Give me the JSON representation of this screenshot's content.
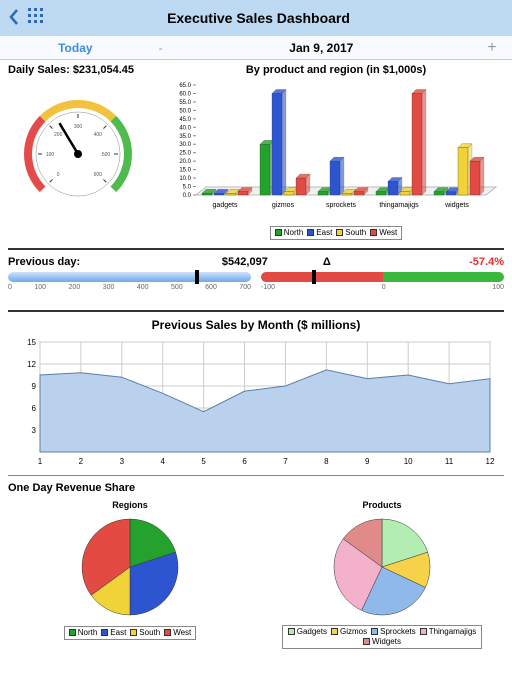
{
  "header": {
    "title": "Executive Sales Dashboard"
  },
  "subheader": {
    "today": "Today",
    "date": "Jan 9, 2017",
    "minus": "-",
    "plus": "+"
  },
  "daily": {
    "label": "Daily Sales: $231,054.45"
  },
  "byproduct": {
    "label": "By product and region (in $1,000s)"
  },
  "prev": {
    "label": "Previous day:",
    "value": "$542,097",
    "delta_label": "Δ",
    "delta_value": "-57.4%"
  },
  "month": {
    "title": "Previous Sales by Month ($ millions)"
  },
  "share": {
    "title": "One Day Revenue Share",
    "regions": "Regions",
    "products": "Products"
  },
  "legend1": [
    "North",
    "East",
    "South",
    "West"
  ],
  "legend2": [
    "Gadgets",
    "Gizmos",
    "Sprockets",
    "Thingamajigs",
    "Widgets"
  ],
  "chart_data": [
    {
      "type": "gauge",
      "title": "Daily Sales",
      "range": [
        0,
        600
      ],
      "ticks": [
        0,
        100,
        200,
        300,
        400,
        500,
        600
      ],
      "value": 231,
      "bands": [
        {
          "from": 0,
          "to": 200,
          "color": "#e54b4b"
        },
        {
          "from": 200,
          "to": 400,
          "color": "#f0c23d"
        },
        {
          "from": 400,
          "to": 600,
          "color": "#4fbb4f"
        }
      ]
    },
    {
      "type": "bar",
      "title": "By product and region (in $1,000s)",
      "categories": [
        "gadgets",
        "gizmos",
        "sprockets",
        "thingamajigs",
        "widgets"
      ],
      "series": [
        {
          "name": "North",
          "color": "#25a22e",
          "values": [
            1,
            30,
            2,
            2,
            2
          ]
        },
        {
          "name": "East",
          "color": "#2d55d0",
          "values": [
            1,
            60,
            20,
            8,
            2
          ]
        },
        {
          "name": "South",
          "color": "#f0d338",
          "values": [
            1,
            2,
            1,
            2,
            28
          ]
        },
        {
          "name": "West",
          "color": "#e24a42",
          "values": [
            2,
            10,
            2,
            60,
            20
          ]
        }
      ],
      "ylim": [
        0,
        65
      ],
      "yticks": [
        0,
        5,
        10,
        15,
        20,
        25,
        30,
        35,
        40,
        45,
        50,
        55,
        60,
        65
      ]
    },
    {
      "type": "bullet",
      "title": "Previous day",
      "range": [
        0,
        700
      ],
      "ticks": [
        0,
        100,
        200,
        300,
        400,
        500,
        600,
        700
      ],
      "value": 542
    },
    {
      "type": "bullet",
      "title": "Δ",
      "range": [
        -100,
        100
      ],
      "ticks": [
        -100,
        0,
        100
      ],
      "value": -57.4,
      "bands": [
        {
          "from": -100,
          "to": 0,
          "color": "#e24a42"
        },
        {
          "from": 0,
          "to": 100,
          "color": "#3bb83b"
        }
      ]
    },
    {
      "type": "area",
      "title": "Previous Sales by Month ($ millions)",
      "x": [
        1,
        2,
        3,
        4,
        5,
        6,
        7,
        8,
        9,
        10,
        11,
        12
      ],
      "values": [
        10.5,
        10.8,
        10.2,
        8.0,
        5.5,
        8.3,
        9.0,
        11.2,
        10.0,
        10.5,
        9.3,
        10.0
      ],
      "ylim": [
        0,
        15
      ],
      "yticks": [
        3,
        6,
        9,
        12,
        15
      ]
    },
    {
      "type": "pie",
      "title": "Regions",
      "series": [
        {
          "name": "North",
          "color": "#25a22e",
          "value": 20
        },
        {
          "name": "East",
          "color": "#2d55d0",
          "value": 30
        },
        {
          "name": "South",
          "color": "#f0d338",
          "value": 15
        },
        {
          "name": "West",
          "color": "#e24a42",
          "value": 35
        }
      ]
    },
    {
      "type": "pie",
      "title": "Products",
      "series": [
        {
          "name": "Gadgets",
          "color": "#b4edb2",
          "value": 20
        },
        {
          "name": "Gizmos",
          "color": "#f5d24a",
          "value": 12
        },
        {
          "name": "Sprockets",
          "color": "#8fb9ea",
          "value": 25
        },
        {
          "name": "Thingamajigs",
          "color": "#f4b1cc",
          "value": 28
        },
        {
          "name": "Widgets",
          "color": "#e08a8a",
          "value": 15
        }
      ]
    }
  ]
}
